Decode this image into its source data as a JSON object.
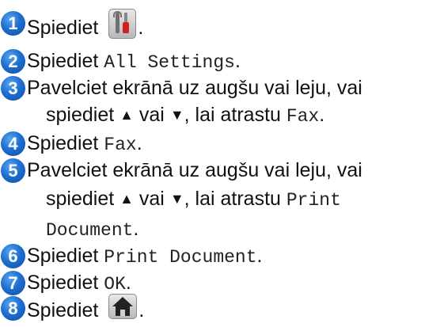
{
  "steps": [
    {
      "number": "1",
      "lines": [
        {
          "before": "Spiediet",
          "icon": "settings-icon",
          "after": "."
        }
      ]
    },
    {
      "number": "2",
      "lines": [
        {
          "text": "Spiediet ",
          "code": "All Settings",
          "after": "."
        }
      ]
    },
    {
      "number": "3",
      "lines": [
        {
          "text": "Pavelciet ekrānā uz augšu vai leju, vai"
        },
        {
          "text": "spiediet ",
          "up": "▲",
          "mid": " vai ",
          "down": "▼",
          "text2": ", lai atrastu ",
          "code": "Fax",
          "after": "."
        }
      ]
    },
    {
      "number": "4",
      "lines": [
        {
          "text": "Spiediet ",
          "code": "Fax",
          "after": "."
        }
      ]
    },
    {
      "number": "5",
      "lines": [
        {
          "text": "Pavelciet ekrānā uz augšu vai leju, vai"
        },
        {
          "text": "spiediet ",
          "up": "▲",
          "mid": " vai ",
          "down": "▼",
          "text2": ", lai atrastu ",
          "code": "Print"
        },
        {
          "code": "Document",
          "after": "."
        }
      ]
    },
    {
      "number": "6",
      "lines": [
        {
          "text": "Spiediet ",
          "code": "Print Document",
          "after": "."
        }
      ]
    },
    {
      "number": "7",
      "lines": [
        {
          "text": "Spiediet ",
          "code": "OK",
          "after": "."
        }
      ]
    },
    {
      "number": "8",
      "lines": [
        {
          "before": "Spiediet",
          "icon": "home-icon",
          "after": "."
        }
      ]
    }
  ],
  "colors": {
    "step_badge": "#1e6fd0",
    "text": "#111111",
    "screwdriver_handle": "#d42020"
  }
}
